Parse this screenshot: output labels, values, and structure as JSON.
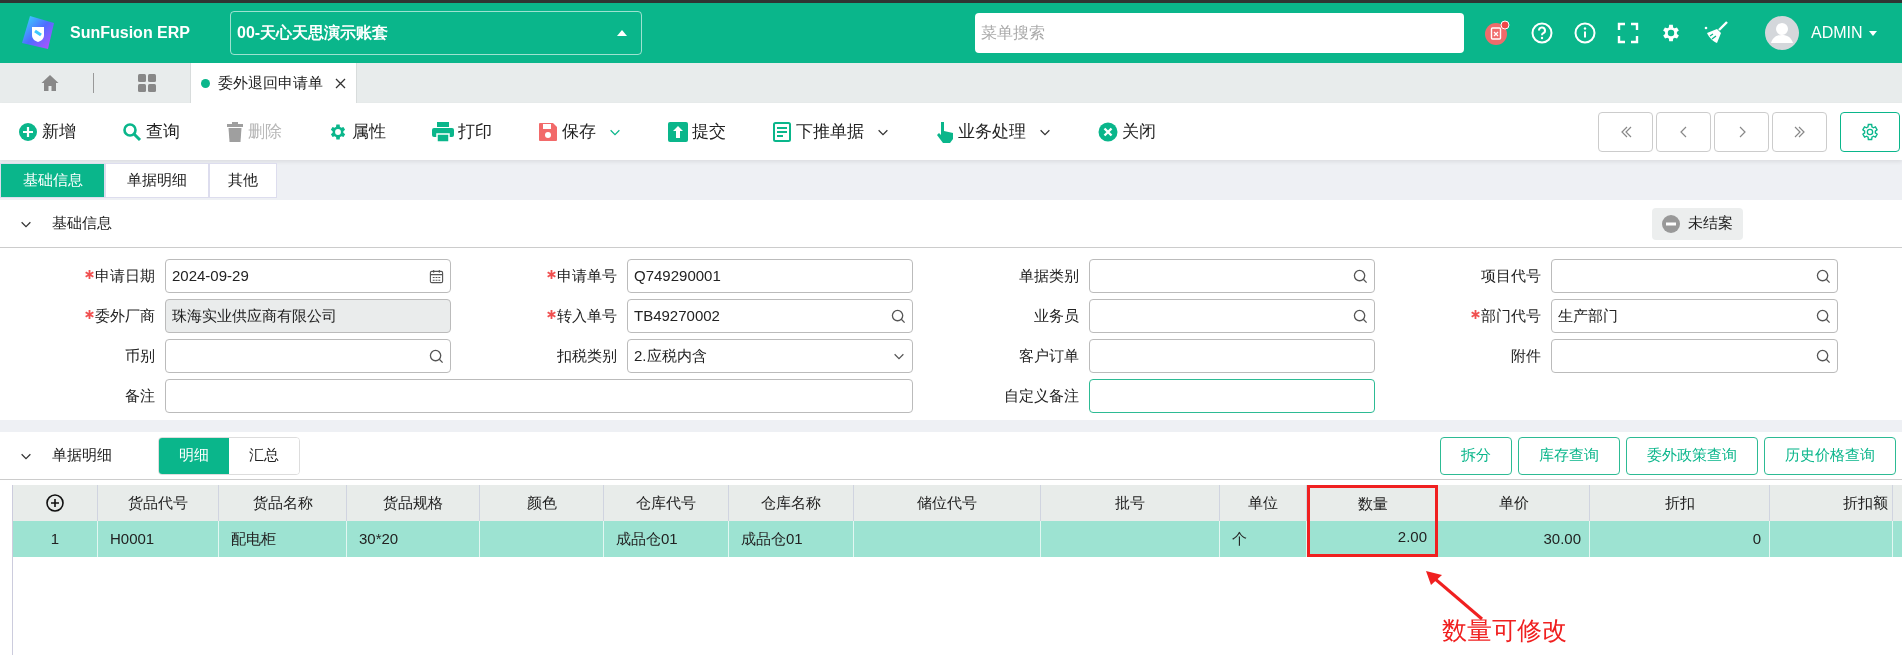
{
  "header": {
    "app_name": "SunFusion ERP",
    "account": "00-天心天思演示账套",
    "search_placeholder": "菜单搜索",
    "user": "ADMIN"
  },
  "page_tabs": [
    {
      "label": "委外退回申请单",
      "selected": true
    }
  ],
  "toolbar": [
    {
      "label": "新增",
      "disabled": false,
      "dropdown": false
    },
    {
      "label": "查询",
      "disabled": false,
      "dropdown": false
    },
    {
      "label": "删除",
      "disabled": true,
      "dropdown": false
    },
    {
      "label": "属性",
      "disabled": false,
      "dropdown": false
    },
    {
      "label": "打印",
      "disabled": false,
      "dropdown": false
    },
    {
      "label": "保存",
      "disabled": false,
      "dropdown": true
    },
    {
      "label": "提交",
      "disabled": false,
      "dropdown": false
    },
    {
      "label": "下推单据",
      "disabled": false,
      "dropdown": true
    },
    {
      "label": "业务处理",
      "disabled": false,
      "dropdown": true
    },
    {
      "label": "关闭",
      "disabled": false,
      "dropdown": false
    }
  ],
  "form_tabs": [
    {
      "label": "基础信息",
      "selected": true
    },
    {
      "label": "单据明细",
      "selected": false
    },
    {
      "label": "其他",
      "selected": false
    }
  ],
  "basic_section": {
    "title": "基础信息",
    "expanded": true,
    "status": "未结案",
    "fields": [
      {
        "label": "申请日期",
        "required": true,
        "kind": "date",
        "value": "2024-09-29",
        "disabled": false,
        "focused": false,
        "wide": false
      },
      {
        "label": "申请单号",
        "required": true,
        "kind": "text",
        "value": "Q749290001",
        "disabled": false,
        "focused": false,
        "wide": false
      },
      {
        "label": "单据类别",
        "required": false,
        "kind": "search",
        "disabled": false,
        "focused": false,
        "wide": false
      },
      {
        "label": "项目代号",
        "required": false,
        "kind": "search",
        "disabled": false,
        "focused": false,
        "wide": false
      },
      {
        "label": "委外厂商",
        "required": true,
        "kind": "text",
        "value": "珠海实业供应商有限公司",
        "disabled": true,
        "focused": false,
        "wide": false
      },
      {
        "label": "转入单号",
        "required": true,
        "kind": "search",
        "value": "TB49270002",
        "disabled": false,
        "focused": false,
        "wide": false
      },
      {
        "label": "业务员",
        "required": false,
        "kind": "search",
        "disabled": false,
        "focused": false,
        "wide": false
      },
      {
        "label": "部门代号",
        "required": true,
        "kind": "search",
        "value": "生产部门",
        "disabled": false,
        "focused": false,
        "wide": false
      },
      {
        "label": "币别",
        "required": false,
        "kind": "search",
        "disabled": false,
        "focused": false,
        "wide": false
      },
      {
        "label": "扣税类别",
        "required": false,
        "kind": "select",
        "value": "2.应税内含",
        "disabled": false,
        "focused": false,
        "wide": false
      },
      {
        "label": "客户订单",
        "required": false,
        "kind": "text",
        "disabled": false,
        "focused": false,
        "wide": false
      },
      {
        "label": "附件",
        "required": false,
        "kind": "search",
        "disabled": false,
        "focused": false,
        "wide": false
      },
      {
        "label": "备注",
        "required": false,
        "kind": "text",
        "disabled": false,
        "focused": false,
        "wide": true
      },
      {
        "label": "自定义备注",
        "required": false,
        "kind": "text",
        "disabled": false,
        "focused": true,
        "wide": false
      }
    ]
  },
  "detail_section": {
    "title": "单据明细",
    "expanded": true,
    "views": [
      {
        "label": "明细",
        "selected": true
      },
      {
        "label": "汇总",
        "selected": false
      }
    ],
    "actions": [
      "拆分",
      "库存查询",
      "委外政策查询",
      "历史价格查询"
    ],
    "table": {
      "columns": [
        {
          "kind": "add",
          "highlighted": false
        },
        {
          "label": "货品代号",
          "kind": "text",
          "highlighted": false
        },
        {
          "label": "货品名称",
          "kind": "text",
          "highlighted": false
        },
        {
          "label": "货品规格",
          "kind": "text",
          "highlighted": false
        },
        {
          "label": "颜色",
          "kind": "text",
          "highlighted": false
        },
        {
          "label": "仓库代号",
          "kind": "text",
          "highlighted": false
        },
        {
          "label": "仓库名称",
          "kind": "text",
          "highlighted": false
        },
        {
          "label": "储位代号",
          "kind": "text",
          "highlighted": false
        },
        {
          "label": "批号",
          "kind": "text",
          "highlighted": false
        },
        {
          "label": "单位",
          "kind": "text",
          "highlighted": false
        },
        {
          "label": "数量",
          "kind": "number",
          "highlighted": true
        },
        {
          "label": "单价",
          "kind": "number",
          "highlighted": false
        },
        {
          "label": "折扣",
          "kind": "number",
          "highlighted": false
        },
        {
          "label": "折扣额",
          "kind": "number",
          "highlighted": false
        }
      ],
      "rows": [
        {
          "selected": true,
          "cells": [
            "1",
            "H0001",
            "配电柜",
            "30*20",
            "",
            "成品仓01",
            "成品仓01",
            "",
            "",
            "个",
            "2.00",
            "30.00",
            "0",
            ""
          ]
        }
      ]
    }
  },
  "annotation": {
    "text": "数量可修改"
  }
}
